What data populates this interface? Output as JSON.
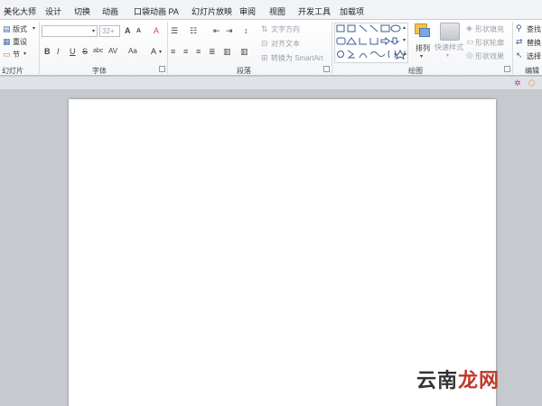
{
  "tabs": [
    "美化大师",
    "设计",
    "切换",
    "动画",
    "口袋动画 PA",
    "幻灯片放映",
    "审阅",
    "视图",
    "开发工具",
    "加载项"
  ],
  "slides_group": {
    "layout": "版式",
    "reset": "重设",
    "section": "节",
    "label": "幻灯片"
  },
  "font_group": {
    "font_size": "32+",
    "increase_font": "A",
    "decrease_font": "A",
    "clear_format": "A",
    "bold": "B",
    "italic": "I",
    "underline": "U",
    "strike": "S",
    "shadow": "abc",
    "spacing": "AV",
    "change_case": "Aa",
    "font_color": "A",
    "label": "字体"
  },
  "paragraph_group": {
    "text_direction": "文字方向",
    "align_text": "对齐文本",
    "convert_smartart": "转换为 SmartArt",
    "label": "段落"
  },
  "drawing_group": {
    "arrange": "排列",
    "quick_styles": "快速样式",
    "shape_fill": "形状填充",
    "shape_outline": "形状轮廓",
    "shape_effects": "形状效果",
    "label": "绘图"
  },
  "editing_group": {
    "find": "查找",
    "replace": "替换",
    "select": "选择",
    "label": "编辑"
  },
  "watermark": {
    "part1": "云南",
    "part2": "龙网"
  }
}
